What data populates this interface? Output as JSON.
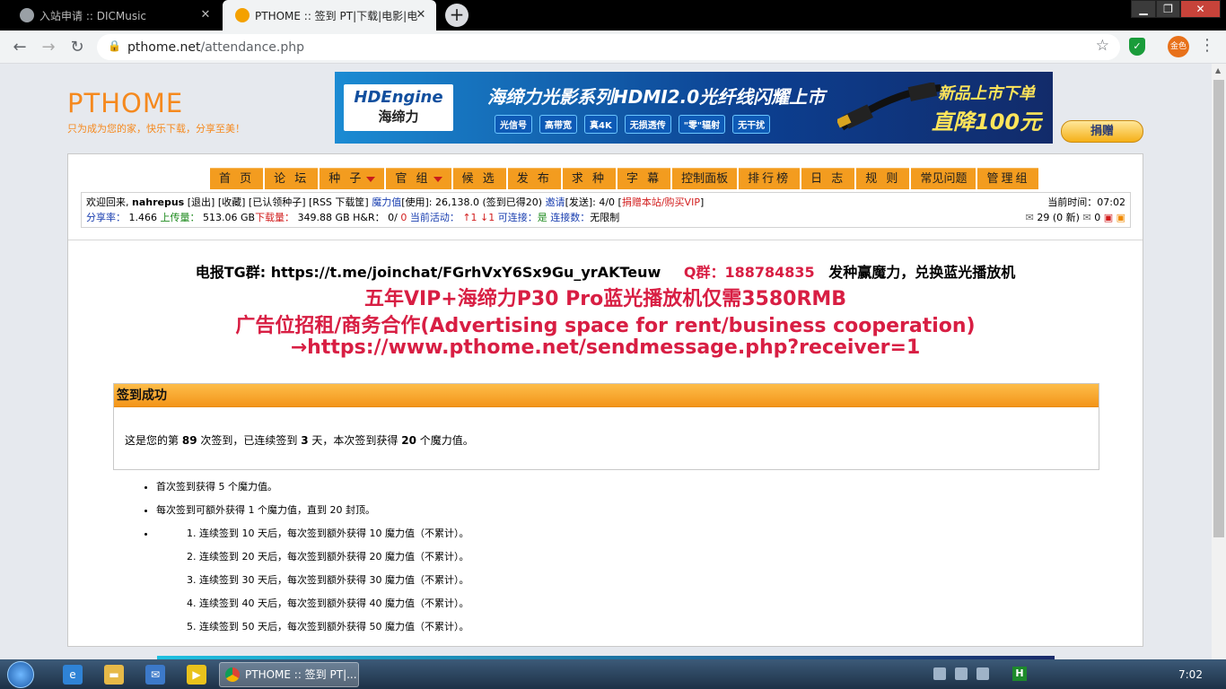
{
  "browser": {
    "tabs": [
      {
        "title": "入站申请 :: DICMusic"
      },
      {
        "title": "PTHOME :: 签到 PT|下载|电影|电"
      }
    ],
    "url_host": "pthome.net",
    "url_path": "/attendance.php",
    "profile_label": "金色"
  },
  "site": {
    "logo_title": "PTHOME",
    "logo_slogan": "只为成为您的家，快乐下载，分享至美！",
    "banner": {
      "brand": "HDEngine",
      "brand_cn": "海缔力",
      "headline": "海缔力光影系列HDMI2.0光纤线闪耀上市",
      "tags": [
        "光信号",
        "高带宽",
        "真4K",
        "无损透传",
        "\"零\"辐射",
        "无干扰"
      ],
      "right_line1": "新品上市下单",
      "right_line2": "直降100元"
    },
    "donate_label": "捐赠"
  },
  "menu": [
    {
      "label": "首 页",
      "dropdown": false
    },
    {
      "label": "论 坛",
      "dropdown": false
    },
    {
      "label": "种 子",
      "dropdown": true
    },
    {
      "label": "官 组",
      "dropdown": true
    },
    {
      "label": "候 选",
      "dropdown": false
    },
    {
      "label": "发 布",
      "dropdown": false
    },
    {
      "label": "求 种",
      "dropdown": false
    },
    {
      "label": "字 幕",
      "dropdown": false
    },
    {
      "label": "控制面板",
      "dropdown": false
    },
    {
      "label": "排行榜",
      "dropdown": false
    },
    {
      "label": "日 志",
      "dropdown": false
    },
    {
      "label": "规 则",
      "dropdown": false
    },
    {
      "label": "常见问题",
      "dropdown": false
    },
    {
      "label": "管理组",
      "dropdown": false
    }
  ],
  "userbar": {
    "welcome": "欢迎回来,",
    "username": "nahrepus",
    "logout": "[退出]",
    "favorites": "[收藏]",
    "claimed": "[已认领种子]",
    "rss": "[RSS 下载筐]",
    "bonus_label": "魔力值",
    "bonus_use": "[使用]",
    "bonus_value": ": 26,138.0 (签到已得20)",
    "invite_label": "邀请",
    "invite_value": "[发送]: 4/0 [",
    "donate_vip": "捐赠本站/购买VIP",
    "bracket_close": "]",
    "ratio_label": "分享率：",
    "ratio_value": "1.466",
    "upload_label": "上传量：",
    "upload_value": "513.06 GB",
    "download_label": "下载量：",
    "download_value": "349.88 GB",
    "hr_label": "H&R：",
    "hr_value": "0/",
    "hr_value2": "0",
    "active_label": "当前活动：",
    "active_value": "↑1 ↓1",
    "connectable_label": "可连接：",
    "connectable_value": "是",
    "connections_label": "连接数：",
    "connections_value": "无限制",
    "time_label": "当前时间：",
    "time_value": "07:02",
    "messages": "29 (0 新)",
    "messages2": "0"
  },
  "announce": {
    "tg": "电报TG群: https://t.me/joinchat/FGrhVxY6Sx9Gu_yrAKTeuw",
    "qq": "Q群：188784835",
    "tg_tail": "发种赢魔力，兑换蓝光播放机",
    "promo1": "五年VIP+海缔力P30 Pro蓝光播放机仅需3580RMB",
    "promo2": "广告位招租/商务合作(Advertising space for rent/business cooperation)",
    "promo3": "→https://www.pthome.net/sendmessage.php?receiver=1"
  },
  "checkin": {
    "title": "签到成功",
    "msg_prefix": "这是您的第",
    "total_days": "89",
    "msg_mid1": "次签到，已连续签到",
    "streak_days": "3",
    "msg_mid2": "天，本次签到获得",
    "points": "20",
    "msg_suffix": "个魔力值。"
  },
  "rules": {
    "items": [
      "首次签到获得 5 个魔力值。",
      "每次签到可额外获得 1 个魔力值，直到 20 封顶。"
    ],
    "bonuses": [
      "连续签到 10 天后，每次签到额外获得 10 魔力值（不累计）。",
      "连续签到 20 天后，每次签到额外获得 20 魔力值（不累计）。",
      "连续签到 30 天后，每次签到额外获得 30 魔力值（不累计）。",
      "连续签到 40 天后，每次签到额外获得 40 魔力值（不累计）。",
      "连续签到 50 天后，每次签到额外获得 50 魔力值（不累计）。"
    ]
  },
  "taskbar": {
    "active_window": "PTHOME :: 签到 PT|...",
    "clock": "7:02"
  }
}
